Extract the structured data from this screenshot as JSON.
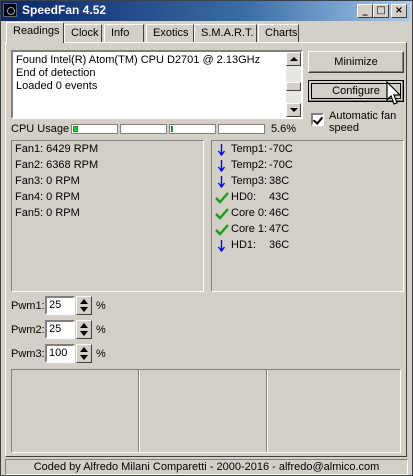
{
  "window": {
    "title": "SpeedFan 4.52"
  },
  "titlebar_buttons": {
    "minimize": "_",
    "maximize": "□",
    "close": "×"
  },
  "tabs": [
    {
      "label": "Readings",
      "active": true
    },
    {
      "label": "Clock"
    },
    {
      "label": "Info"
    },
    {
      "label": "Exotics"
    },
    {
      "label": "S.M.A.R.T."
    },
    {
      "label": "Charts"
    }
  ],
  "log": [
    "Found Intel(R) Atom(TM) CPU D2701 @ 2.13GHz",
    "End of detection",
    "Loaded 0 events"
  ],
  "buttons": {
    "minimize": "Minimize",
    "configure": "Configure"
  },
  "auto_fan": {
    "label_line1": "Automatic fan",
    "label_line2": "speed",
    "checked": true
  },
  "cpu_usage": {
    "label": "CPU Usage",
    "value": "5.6%",
    "cores_percent": [
      5,
      0,
      1,
      0
    ]
  },
  "fans": [
    "Fan1: 6429 RPM",
    "Fan2: 6368 RPM",
    "Fan3: 0 RPM",
    "Fan4: 0 RPM",
    "Fan5: 0 RPM"
  ],
  "temps": [
    {
      "name": "Temp1:",
      "value": "-70C",
      "status": "down-arrow-icon"
    },
    {
      "name": "Temp2:",
      "value": "-70C",
      "status": "down-arrow-icon"
    },
    {
      "name": "Temp3:",
      "value": "38C",
      "status": "down-arrow-icon"
    },
    {
      "name": "HD0:",
      "value": "43C",
      "status": "checkmark-icon"
    },
    {
      "name": "Core 0:",
      "value": "46C",
      "status": "checkmark-icon"
    },
    {
      "name": "Core 1:",
      "value": "47C",
      "status": "checkmark-icon"
    },
    {
      "name": "HD1:",
      "value": "36C",
      "status": "down-arrow-icon"
    }
  ],
  "pwm": [
    {
      "label": "Pwm1:",
      "value": "25",
      "unit": "%"
    },
    {
      "label": "Pwm2:",
      "value": "25",
      "unit": "%"
    },
    {
      "label": "Pwm3:",
      "value": "100",
      "unit": "%"
    }
  ],
  "status_bar": "Coded by Alfredo Milani Comparetti - 2000-2016 - alfredo@almico.com",
  "colors": {
    "accent_arrow": "#0000ff",
    "accent_check": "#1a9e1a",
    "cpu_bar_fill": "#2ecc40"
  }
}
